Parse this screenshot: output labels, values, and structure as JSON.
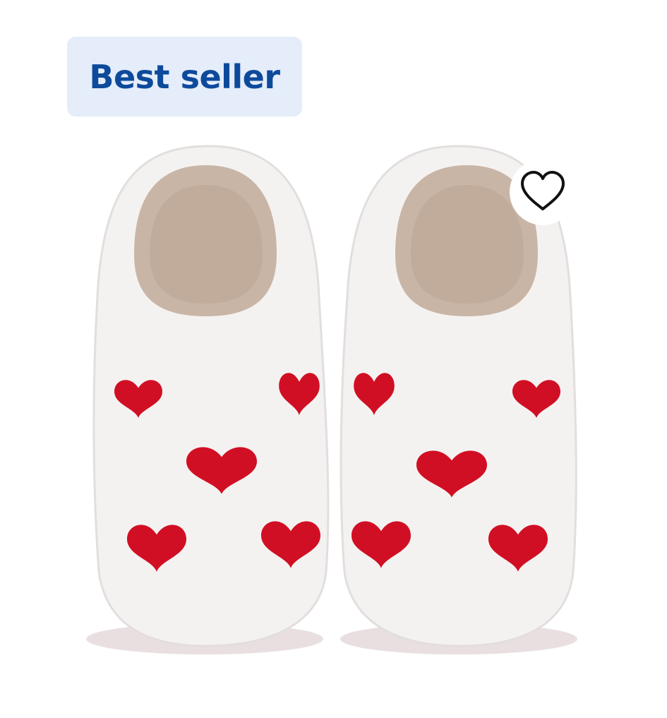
{
  "badge": {
    "label": "Best seller"
  },
  "product_image": {
    "icon": "heart-slippers-image",
    "slipper_color": "#f2efec",
    "lining_color": "#c9b5a6",
    "heart_color": "#d10f24"
  },
  "favorite_button": {
    "icon": "heart-outline-icon"
  }
}
